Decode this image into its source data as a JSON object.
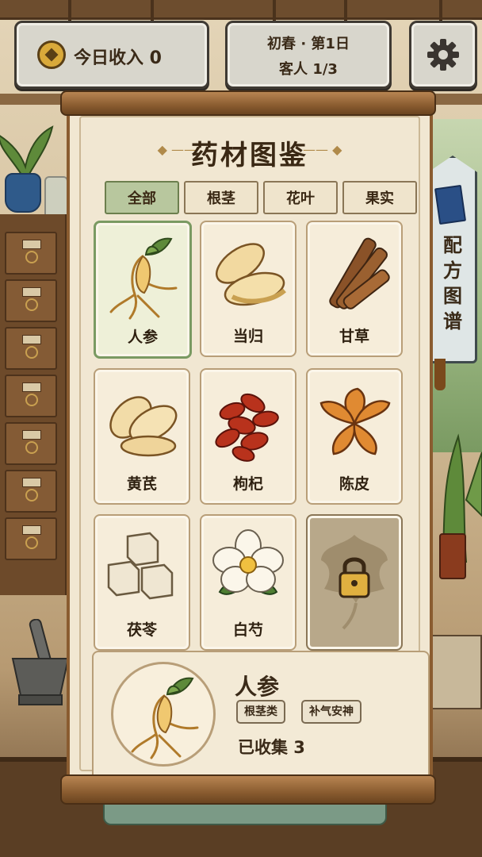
{
  "hud": {
    "income_label": "今日收入 0",
    "season_day": "初春 · 第1日",
    "customers": "客人 1/3"
  },
  "side_tab": {
    "label": "配方图谱"
  },
  "book": {
    "title": "药材图鉴",
    "tabs": [
      {
        "label": "全部",
        "active": true
      },
      {
        "label": "根茎",
        "active": false
      },
      {
        "label": "花叶",
        "active": false
      },
      {
        "label": "果实",
        "active": false
      }
    ],
    "herbs": [
      {
        "name": "人参",
        "icon": "ginseng-icon",
        "selected": true
      },
      {
        "name": "当归",
        "icon": "angelica-slices-icon"
      },
      {
        "name": "甘草",
        "icon": "licorice-sticks-icon"
      },
      {
        "name": "黄芪",
        "icon": "astragalus-slices-icon"
      },
      {
        "name": "枸杞",
        "icon": "goji-berries-icon"
      },
      {
        "name": "陈皮",
        "icon": "tangerine-peel-icon"
      },
      {
        "name": "茯苓",
        "icon": "poria-cubes-icon"
      },
      {
        "name": "白芍",
        "icon": "white-peony-icon"
      },
      {
        "name": "",
        "icon": "lock-icon",
        "locked": true
      }
    ],
    "detail": {
      "name": "人参",
      "tags": [
        "根茎类",
        "补气安神"
      ],
      "collected": "已收集 3"
    }
  },
  "colors": {
    "active_tab": "#b8c79e",
    "paper": "#f1e7d2",
    "wood": "#8a5c30"
  }
}
